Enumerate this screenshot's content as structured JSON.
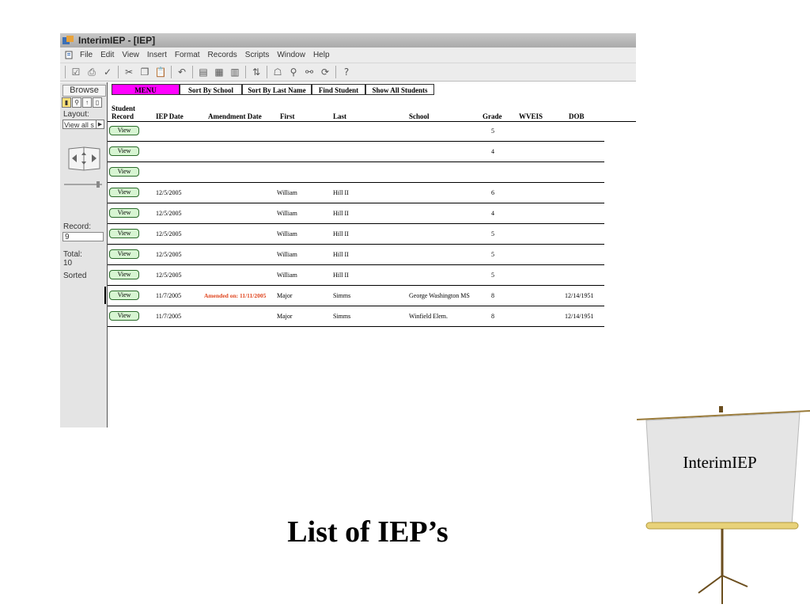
{
  "window": {
    "title": "InterimIEP - [IEP]",
    "menu": [
      "File",
      "Edit",
      "View",
      "Insert",
      "Format",
      "Records",
      "Scripts",
      "Window",
      "Help"
    ]
  },
  "status": {
    "mode": "Browse",
    "layout_label": "Layout:",
    "layout_value": "View all s",
    "record_label": "Record:",
    "record_value": "9",
    "total_label": "Total:",
    "total_value": "10",
    "sorted_label": "Sorted"
  },
  "nav": {
    "menu": "MENU",
    "sort_school": "Sort By School",
    "sort_last": "Sort By Last Name",
    "find": "Find Student",
    "show_all": "Show All Students"
  },
  "columns": {
    "student_record_1": "Student",
    "student_record_2": "Record",
    "iep_date": "IEP Date",
    "amendment_date": "Amendment Date",
    "first": "First",
    "last": "Last",
    "school": "School",
    "grade": "Grade",
    "wveis": "WVEIS",
    "dob": "DOB"
  },
  "view_label": "View",
  "rows": [
    {
      "iep_date": "",
      "amendment": "",
      "first": "",
      "last": "",
      "school": "",
      "grade": "5",
      "wveis": "",
      "dob": ""
    },
    {
      "iep_date": "",
      "amendment": "",
      "first": "",
      "last": "",
      "school": "",
      "grade": "4",
      "wveis": "",
      "dob": ""
    },
    {
      "iep_date": "",
      "amendment": "",
      "first": "",
      "last": "",
      "school": "",
      "grade": "",
      "wveis": "",
      "dob": ""
    },
    {
      "iep_date": "12/5/2005",
      "amendment": "",
      "first": "William",
      "last": "Hill II",
      "school": "",
      "grade": "6",
      "wveis": "",
      "dob": ""
    },
    {
      "iep_date": "12/5/2005",
      "amendment": "",
      "first": "William",
      "last": "Hill II",
      "school": "",
      "grade": "4",
      "wveis": "",
      "dob": ""
    },
    {
      "iep_date": "12/5/2005",
      "amendment": "",
      "first": "William",
      "last": "Hill II",
      "school": "",
      "grade": "5",
      "wveis": "",
      "dob": ""
    },
    {
      "iep_date": "12/5/2005",
      "amendment": "",
      "first": "William",
      "last": "Hill II",
      "school": "",
      "grade": "5",
      "wveis": "",
      "dob": ""
    },
    {
      "iep_date": "12/5/2005",
      "amendment": "",
      "first": "William",
      "last": "Hill II",
      "school": "",
      "grade": "5",
      "wveis": "",
      "dob": ""
    },
    {
      "iep_date": "11/7/2005",
      "amendment": "Amended on: 11/11/2005",
      "first": "Major",
      "last": "Simms",
      "school": "George Washington MS",
      "grade": "8",
      "wveis": "",
      "dob": "12/14/1951"
    },
    {
      "iep_date": "11/7/2005",
      "amendment": "",
      "first": "Major",
      "last": "Simms",
      "school": "Winfield Elem.",
      "grade": "8",
      "wveis": "",
      "dob": "12/14/1951"
    }
  ],
  "slide": {
    "title": "List of IEP’s",
    "easel_label": "InterimIEP"
  }
}
